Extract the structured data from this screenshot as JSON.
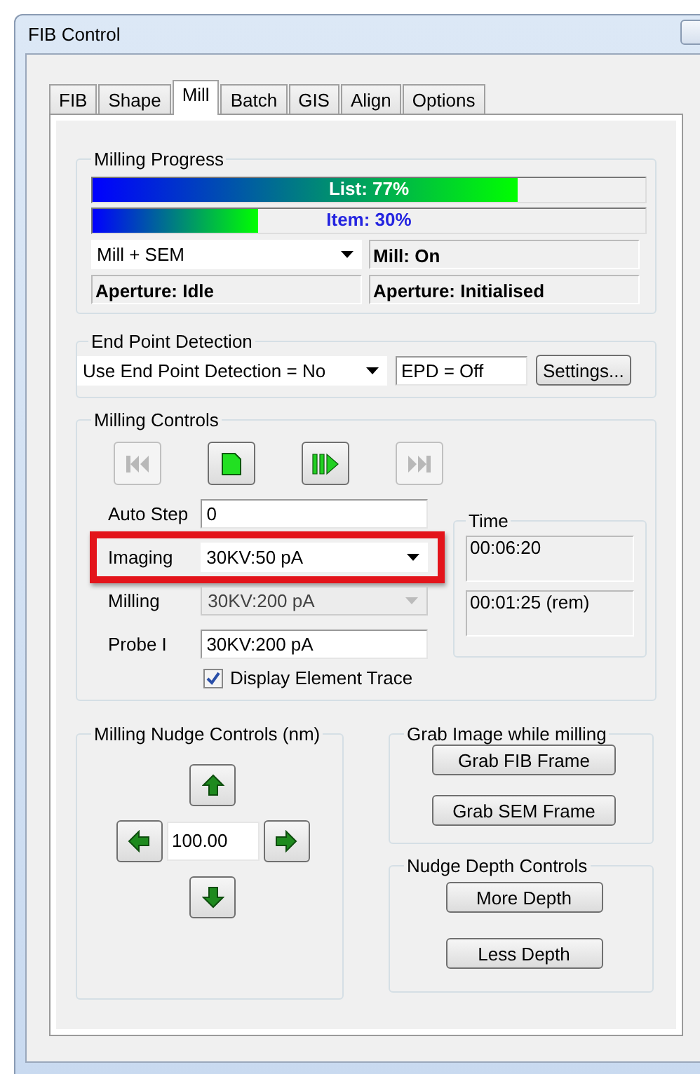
{
  "window": {
    "title": "FIB Control"
  },
  "tabs": [
    {
      "label": "FIB",
      "selected": false
    },
    {
      "label": "Shape",
      "selected": false
    },
    {
      "label": "Mill",
      "selected": true
    },
    {
      "label": "Batch",
      "selected": false
    },
    {
      "label": "GIS",
      "selected": false
    },
    {
      "label": "Align",
      "selected": false
    },
    {
      "label": "Options",
      "selected": false
    }
  ],
  "milling_progress": {
    "title": "Milling Progress",
    "bars": [
      {
        "label": "List: 77%",
        "level": 0.77,
        "kind": "list"
      },
      {
        "label": "Item: 30%",
        "level": 0.3,
        "kind": "item"
      }
    ],
    "mode": {
      "value": "Mill + SEM"
    },
    "status": [
      "Mill: On",
      "Aperture: Idle",
      "Aperture: Initialised"
    ]
  },
  "end_point_detection": {
    "title": "End Point Detection",
    "mode": {
      "value": "Use End Point Detection = No"
    },
    "epd": {
      "value": "EPD = Off"
    },
    "settings_button": "Settings..."
  },
  "milling_controls": {
    "title": "Milling Controls",
    "transport": [
      {
        "kind": "first",
        "disabled": true
      },
      {
        "kind": "stop",
        "disabled": false
      },
      {
        "kind": "step",
        "disabled": false
      },
      {
        "kind": "last",
        "disabled": true
      }
    ],
    "rows": [
      {
        "label": "Auto Step",
        "kind": "text",
        "value": "0",
        "disabled": false,
        "highlighted": false
      },
      {
        "label": "Imaging",
        "kind": "dropdown",
        "value": "30KV:50 pA",
        "disabled": false,
        "highlighted": true
      },
      {
        "label": "Milling",
        "kind": "dropdown",
        "value": "30KV:200 pA",
        "disabled": true,
        "highlighted": false
      },
      {
        "label": "Probe I",
        "kind": "text",
        "value": "30KV:200 pA",
        "disabled": false,
        "highlighted": false
      }
    ],
    "display_trace": {
      "label": "Display Element Trace",
      "checked": true
    },
    "time": {
      "title": "Time",
      "values": [
        "00:06:20",
        "00:01:25 (rem)"
      ]
    }
  },
  "nudge_controls": {
    "title": "Milling Nudge Controls (nm)",
    "value": "100.00"
  },
  "grab_image": {
    "title": "Grab Image while milling",
    "buttons": [
      "Grab FIB Frame",
      "Grab SEM Frame"
    ]
  },
  "nudge_depth": {
    "title": "Nudge Depth Controls",
    "buttons": [
      "More Depth",
      "Less Depth"
    ]
  }
}
